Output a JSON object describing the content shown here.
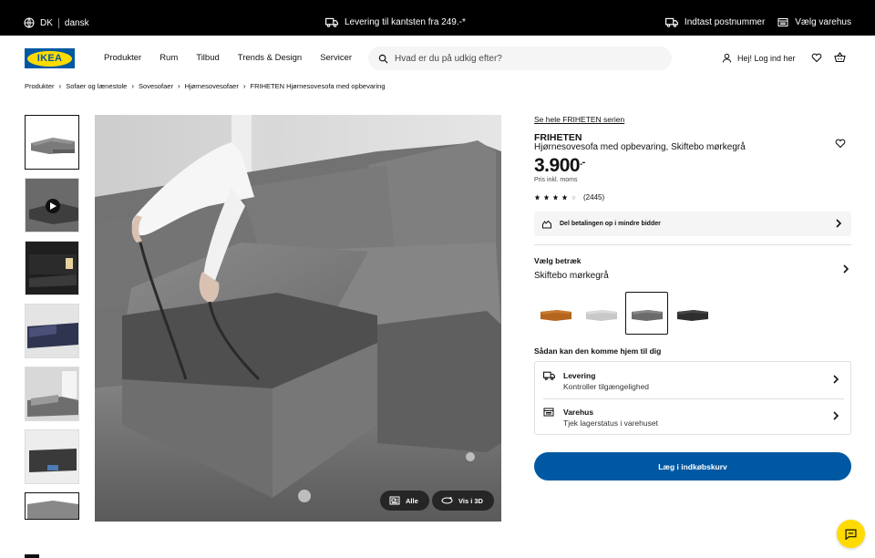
{
  "utility_bar": {
    "country": "DK",
    "language": "dansk",
    "delivery_promo": "Levering til kantsten fra 249.-*",
    "postcode_label": "Indtast postnummer",
    "store_label": "Vælg varehus"
  },
  "header": {
    "logo_text": "IKEA",
    "nav": [
      "Produkter",
      "Rum",
      "Tilbud",
      "Trends & Design",
      "Servicer"
    ],
    "search_placeholder": "Hvad er du på udkig efter?",
    "login_label": "Hej! Log ind her"
  },
  "breadcrumb": [
    "Produkter",
    "Sofaer og lænestole",
    "Sovesofaer",
    "Hjørnesovesofaer",
    "FRIHETEN Hjørnesovesofa med opbevaring"
  ],
  "gallery": {
    "thumbnail_names": [
      "thumb-sofa-front",
      "thumb-video",
      "thumb-dark-room",
      "thumb-bedroom-blue",
      "thumb-bedroom-grey",
      "thumb-living-room",
      "thumb-detail"
    ],
    "buttons": {
      "all_label": "Alle",
      "view3d_label": "Vis i 3D"
    }
  },
  "product": {
    "series_link": "Se hele FRIHETEN serien",
    "name": "FRIHETEN",
    "description": "Hjørnesovesofa med opbevaring, Skiftebo mørkegrå",
    "price_integer": "3.900",
    "price_suffix": ".-",
    "price_note": "Pris inkl. moms",
    "rating": 4,
    "rating_max": 5,
    "review_count": "(2445)",
    "payment_label": "Del betalingen op i mindre bidder",
    "cover_title": "Vælg betræk",
    "cover_value": "Skiftebo mørkegrå",
    "swatches": [
      {
        "name": "swatch-brown",
        "color": "#b5651d"
      },
      {
        "name": "swatch-light-grey",
        "color": "#c8c8c8"
      },
      {
        "name": "swatch-dark-grey",
        "color": "#6b6b6b",
        "selected": true
      },
      {
        "name": "swatch-black",
        "color": "#2e2e2e"
      }
    ],
    "home_title": "Sådan kan den komme hjem til dig",
    "delivery": {
      "title": "Levering",
      "subtitle": "Kontroller tilgængelighed"
    },
    "store": {
      "title": "Varehus",
      "subtitle": "Tjek lagerstatus i varehuset"
    },
    "cart_label": "Læg i indkøbskurv"
  },
  "colors": {
    "brand_blue": "#0058a3",
    "brand_yellow": "#ffdb00"
  }
}
